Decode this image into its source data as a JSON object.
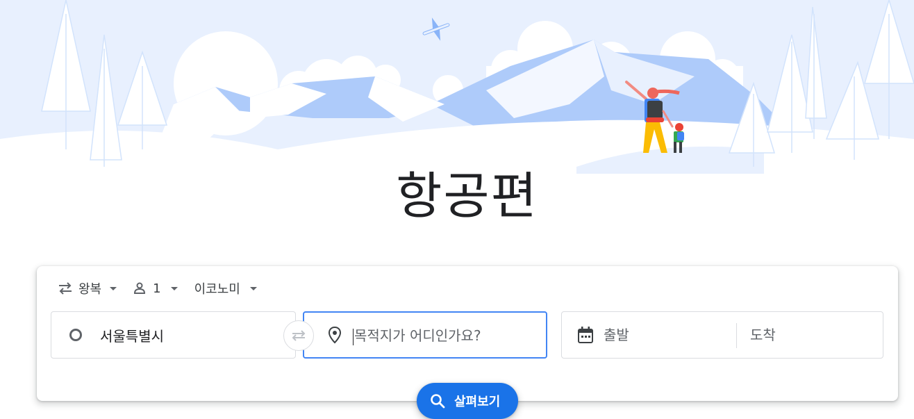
{
  "page": {
    "title": "항공편"
  },
  "options": {
    "trip_type": "왕복",
    "passengers": "1",
    "cabin_class": "이코노미"
  },
  "search": {
    "origin_value": "서울특별시",
    "destination_placeholder": "목적지가 어디인가요?",
    "depart_placeholder": "출발",
    "return_placeholder": "도착",
    "explore_label": "살펴보기"
  },
  "icons": {
    "trip_type": "swap-horiz-icon",
    "passengers": "person-icon",
    "dropdown": "caret-down-icon",
    "origin": "circle-outline-icon",
    "swap": "swap-arrows-icon",
    "destination": "location-pin-icon",
    "calendar": "calendar-icon",
    "search": "search-icon",
    "illustration": "mountains-hikers-illustration"
  },
  "colors": {
    "accent": "#1a73e8",
    "focus_border": "#4285f4",
    "hero_sky": "#e8f0fe",
    "hero_mountain": "#aecbfa"
  }
}
